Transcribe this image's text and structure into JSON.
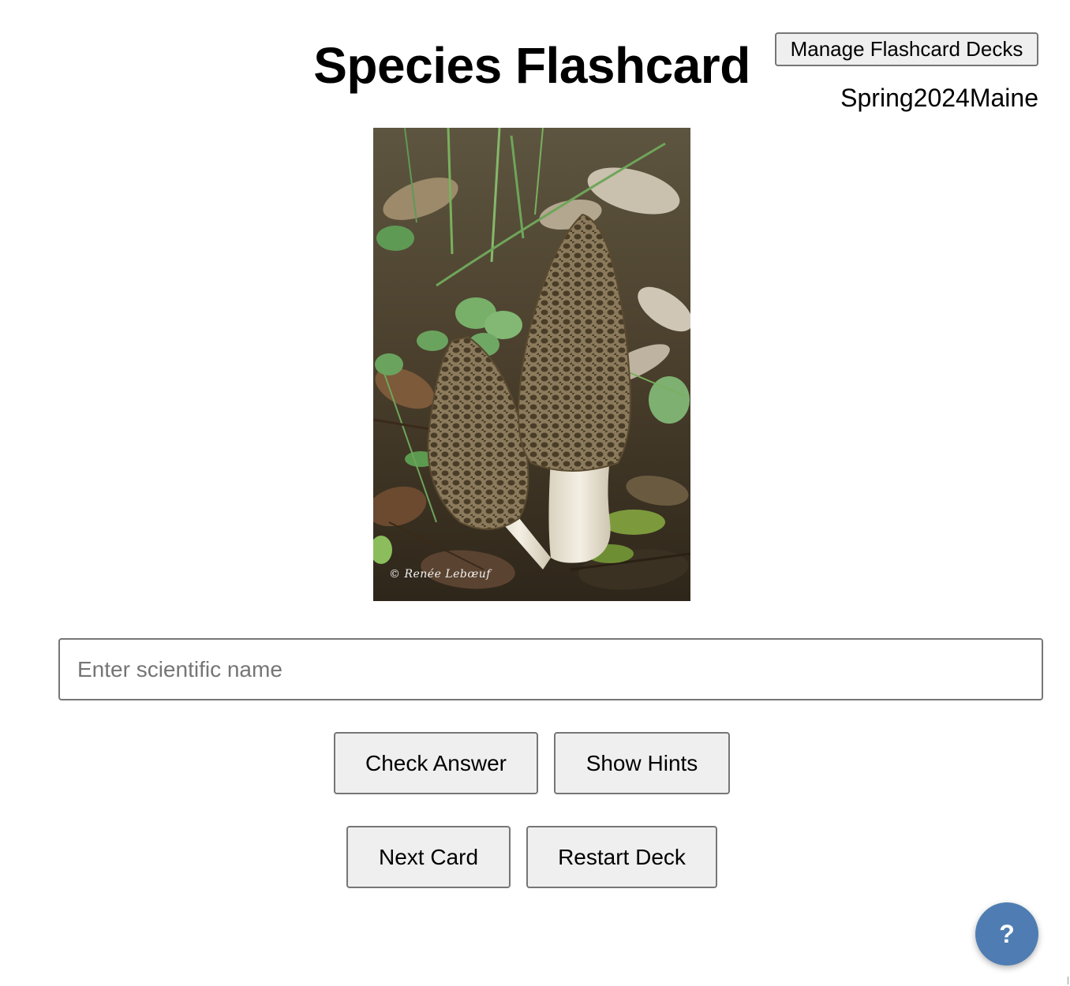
{
  "header": {
    "title": "Species Flashcard",
    "manage_decks_label": "Manage Flashcard Decks",
    "current_deck": "Spring2024Maine"
  },
  "card": {
    "image_credit": "© Renée Lebœuf"
  },
  "answer": {
    "placeholder": "Enter scientific name",
    "value": ""
  },
  "actions": {
    "check_answer_label": "Check Answer",
    "show_hints_label": "Show Hints",
    "next_card_label": "Next Card",
    "restart_deck_label": "Restart Deck"
  },
  "help": {
    "label": "?",
    "color": "#4f7db3"
  }
}
